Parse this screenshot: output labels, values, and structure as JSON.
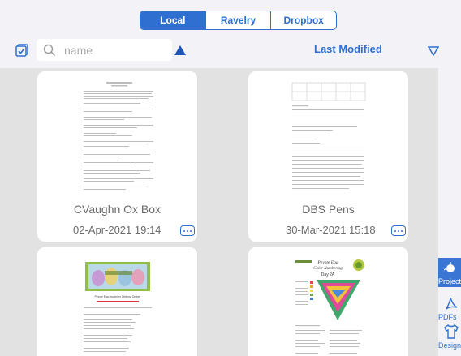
{
  "tabs": [
    "Local",
    "Ravelry",
    "Dropbox"
  ],
  "search": {
    "placeholder": "name"
  },
  "sort": {
    "label": "Last Modified"
  },
  "files": [
    {
      "title": "CVaughn Ox Box",
      "date": "02-Apr-2021 19:14"
    },
    {
      "title": "DBS Pens",
      "date": "30-Mar-2021 15:18"
    },
    {
      "title": "",
      "date": ""
    },
    {
      "title": "",
      "date": ""
    }
  ],
  "sidebar": [
    {
      "label": "Projects",
      "icon": "ball-icon"
    },
    {
      "label": "PDFs",
      "icon": "pdf-icon"
    },
    {
      "label": "Designs",
      "icon": "shirt-icon"
    }
  ],
  "thumb3": {
    "heading": "Peyote Egg (model by Dihlinea Online)"
  },
  "thumb4": {
    "heading": "Peyote Egg",
    "sub": "Color Numbering",
    "day": "Day 2A"
  },
  "colors": {
    "accent": "#2f6fd0",
    "background": "#e2e2e2"
  }
}
